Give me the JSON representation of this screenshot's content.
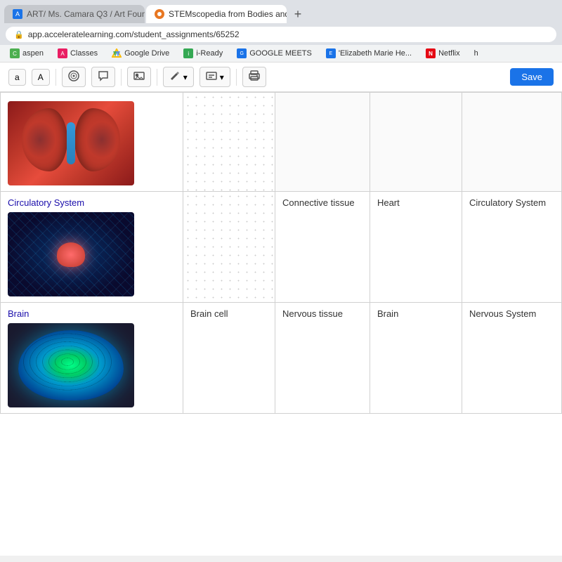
{
  "browser": {
    "tabs": [
      {
        "id": "tab1",
        "label": "ART/ Ms. Camara Q3 / Art Foun...",
        "active": false,
        "icon_color": "#1a73e8"
      },
      {
        "id": "tab2",
        "label": "STEMscopedia from Bodies and ...",
        "active": true,
        "icon_color": "#e87722"
      }
    ],
    "new_tab_label": "+",
    "address": "app.acceleratelearning.com/student_assignments/65252",
    "address_icon": "🔒",
    "bookmarks": [
      {
        "id": "aspen",
        "label": "aspen",
        "icon_color": "#4caf50"
      },
      {
        "id": "classes",
        "label": "Classes",
        "icon_color": "#e91e63"
      },
      {
        "id": "gdrive",
        "label": "Google Drive",
        "icon_color": "#fbbc04"
      },
      {
        "id": "iready",
        "label": "i-Ready",
        "icon_color": "#34a853"
      },
      {
        "id": "gmeets",
        "label": "GOOGLE MEETS",
        "icon_color": "#1a73e8"
      },
      {
        "id": "elizabeth",
        "label": "'Elizabeth Marie He...",
        "icon_color": "#1a73e8"
      },
      {
        "id": "netflix",
        "label": "Netflix",
        "icon_color": "#e50914"
      },
      {
        "id": "h",
        "label": "h",
        "icon_color": "#555"
      }
    ]
  },
  "toolbar": {
    "font_small": "a",
    "font_large": "A",
    "audio_icon": "audio",
    "comment_icon": "comment",
    "image_icon": "image",
    "pen_icon": "pen",
    "edit_icon": "edit",
    "print_icon": "print",
    "save_label": "Save"
  },
  "table": {
    "rows": [
      {
        "id": "row-kidney",
        "col1_label": "",
        "col1_image": "kidney",
        "col2": "",
        "col3": "",
        "col4": "",
        "col5": ""
      },
      {
        "id": "row-circulatory",
        "col1_label": "Circulatory System",
        "col1_image": "circulatory",
        "col2": "",
        "col3": "Connective tissue",
        "col4": "Heart",
        "col5": "Circulatory System"
      },
      {
        "id": "row-brain",
        "col1_label": "Brain",
        "col1_image": "brain",
        "col2": "Brain cell",
        "col3": "Nervous tissue",
        "col4": "Brain",
        "col5": "Nervous System"
      }
    ]
  }
}
